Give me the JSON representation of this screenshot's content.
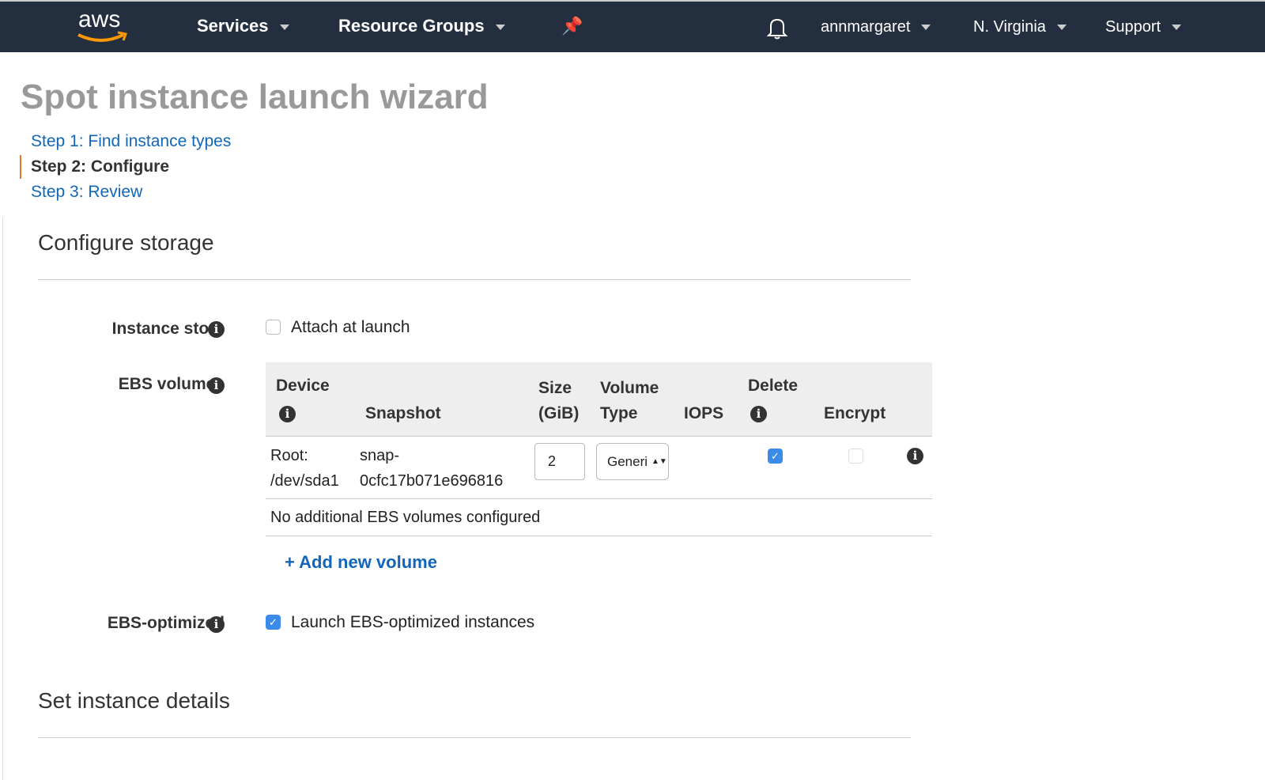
{
  "nav": {
    "logo": "aws",
    "services": "Services",
    "resource_groups": "Resource Groups",
    "user": "annmargaret",
    "region": "N. Virginia",
    "support": "Support"
  },
  "page": {
    "title": "Spot instance launch wizard"
  },
  "steps": [
    {
      "label": "Step 1: Find instance types"
    },
    {
      "label": "Step 2: Configure"
    },
    {
      "label": "Step 3: Review"
    }
  ],
  "storage": {
    "heading": "Configure storage",
    "instance_store_label": "Instance store",
    "attach_label": "Attach at launch",
    "attach_checked": false,
    "ebs_label": "EBS volumes",
    "columns": {
      "device": "Device",
      "snapshot": "Snapshot",
      "size1": "Size",
      "size2": "(GiB)",
      "vtype1": "Volume",
      "vtype2": "Type",
      "iops": "IOPS",
      "delete": "Delete",
      "encrypt": "Encrypt"
    },
    "rows": [
      {
        "device1": "Root:",
        "device2": "/dev/sda1",
        "snap1": "snap-",
        "snap2": "0cfc17b071e696816",
        "size": "2",
        "volume_type": "Generi",
        "delete": true,
        "encrypt": false
      }
    ],
    "empty_msg": "No additional EBS volumes configured",
    "add_volume": "+ Add new volume",
    "ebs_opt_label": "EBS-optimized",
    "ebs_opt_text": "Launch EBS-optimized instances",
    "ebs_opt_checked": true
  },
  "details": {
    "heading": "Set instance details"
  },
  "info_glyph": "i"
}
